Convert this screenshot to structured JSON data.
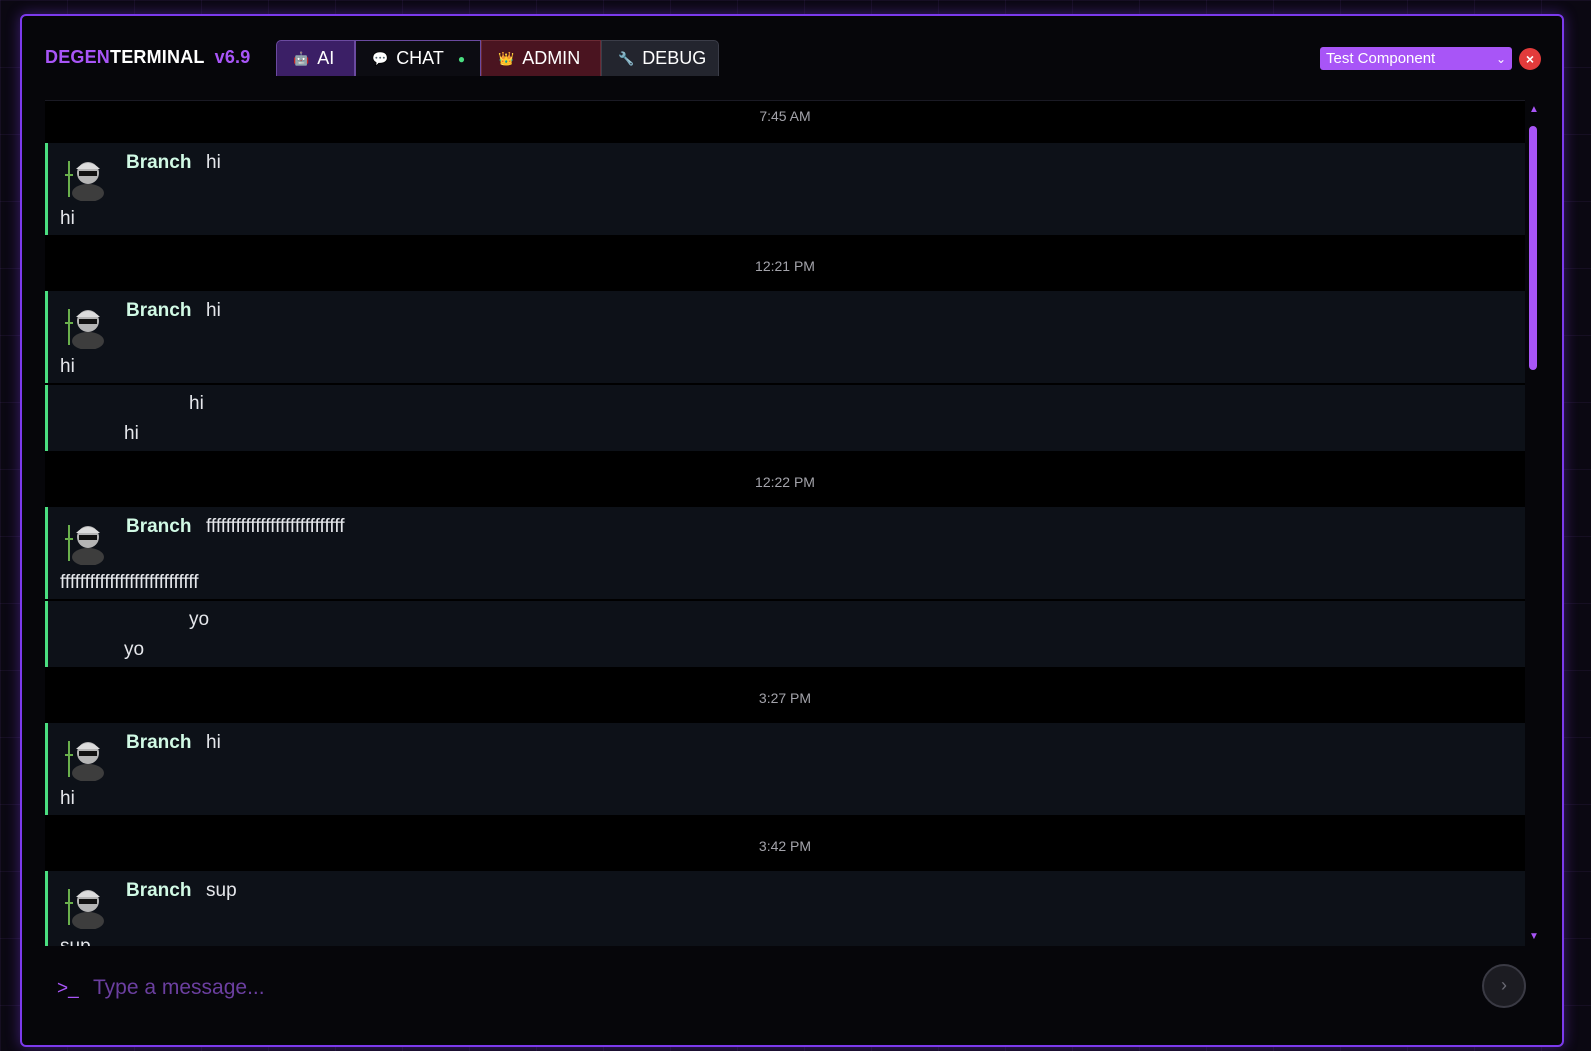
{
  "brand": {
    "degen": "DEGEN",
    "terminal": "TERMINAL",
    "version": "v6.9"
  },
  "tabs": [
    {
      "label": "AI",
      "icon": "robot-icon"
    },
    {
      "label": "CHAT",
      "icon": "speech-bubble-icon"
    },
    {
      "label": "ADMIN",
      "icon": "crown-icon"
    },
    {
      "label": "DEBUG",
      "icon": "wrench-icon"
    }
  ],
  "component_select": {
    "value": "Test Component"
  },
  "messages": [
    {
      "time": "7:45 AM"
    },
    {
      "author": "Branch",
      "head": "hi",
      "body": "hi"
    },
    {
      "time": "12:21 PM"
    },
    {
      "author": "Branch",
      "head": "hi",
      "body": "hi"
    },
    {
      "head": "hi",
      "body": "hi"
    },
    {
      "time": "12:22 PM"
    },
    {
      "author": "Branch",
      "head": "ffffffffffffffffffffffffffff",
      "body": "ffffffffffffffffffffffffffff"
    },
    {
      "head": "yo",
      "body": "yo"
    },
    {
      "time": "3:27 PM"
    },
    {
      "author": "Branch",
      "head": "hi",
      "body": "hi"
    },
    {
      "time": "3:42 PM"
    },
    {
      "author": "Branch",
      "head": "sup",
      "body": "sup"
    }
  ],
  "input": {
    "prompt": ">_",
    "placeholder": "Type a message..."
  },
  "colors": {
    "accent": "#a855f7",
    "online": "#4ade80",
    "close": "#e23b3b",
    "message_border": "#4ade80"
  }
}
